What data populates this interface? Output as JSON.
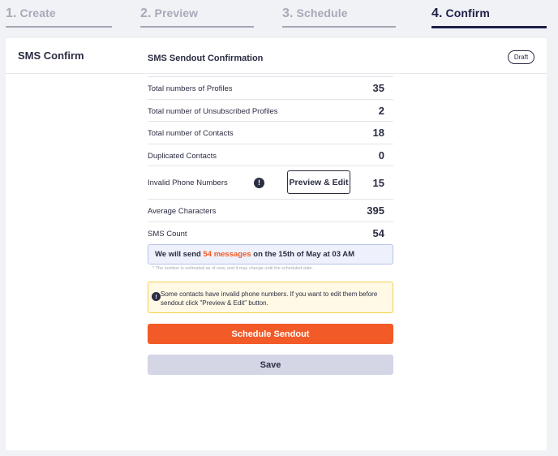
{
  "steps": [
    {
      "num": "1.",
      "label": "Create"
    },
    {
      "num": "2.",
      "label": "Preview"
    },
    {
      "num": "3.",
      "label": "Schedule"
    },
    {
      "num": "4.",
      "label": "Confirm"
    }
  ],
  "card": {
    "title": "SMS Confirm",
    "status_badge": "Draft"
  },
  "summary": {
    "title": "SMS Sendout Confirmation",
    "rows": [
      {
        "label": "Total numbers of Profiles",
        "value": "35"
      },
      {
        "label": "Total number of Unsubscribed Profiles",
        "value": "2"
      },
      {
        "label": "Total number of Contacts",
        "value": "18"
      },
      {
        "label": "Duplicated Contacts",
        "value": "0"
      },
      {
        "label": "Invalid Phone Numbers",
        "value": "15",
        "info_icon": "!",
        "button_label": "Preview & Edit"
      },
      {
        "label": "Average Characters",
        "value": "395"
      },
      {
        "label": "SMS Count",
        "value": "54"
      }
    ]
  },
  "notice": {
    "prefix": "We will send ",
    "highlight": "54 messages",
    "suffix": " on the 15th of May at 03 AM"
  },
  "disclaimer": "* The number is estimated as of now, and it may change until the scheduled date.",
  "warning": {
    "icon": "!",
    "text": "Some contacts have invalid phone numbers. If you want to edit them before sendout click \"Preview & Edit\" button."
  },
  "actions": {
    "schedule_label": "Schedule Sendout",
    "save_label": "Save"
  },
  "colors": {
    "accent": "#f25a27",
    "dark": "#2b2d42",
    "active_step": "#1e2047",
    "warning_bg": "#fff9e5",
    "notice_bg": "#eef1fb"
  }
}
